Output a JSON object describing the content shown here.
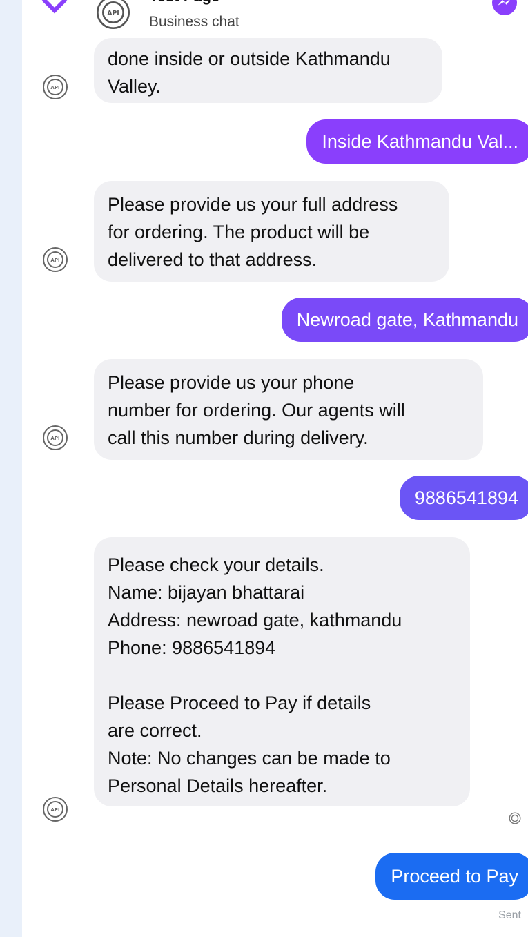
{
  "header": {
    "title": "Test Page",
    "subtitle": "Business chat"
  },
  "messages": [
    {
      "from": "bot",
      "text": "done inside or outside Kathmandu\nValley."
    },
    {
      "from": "user",
      "text": "Inside Kathmandu Val..."
    },
    {
      "from": "bot",
      "text": "Please provide us your full address\nfor ordering. The product will be\ndelivered to that address."
    },
    {
      "from": "user",
      "text": "Newroad gate, Kathmandu"
    },
    {
      "from": "bot",
      "text": "Please provide us your phone\nnumber for ordering. Our agents will\ncall this number during delivery."
    },
    {
      "from": "user",
      "text": "9886541894"
    },
    {
      "from": "bot",
      "text": "Please check your details.\nName: bijayan bhattarai\nAddress: newroad gate, kathmandu\nPhone: 9886541894\n\nPlease Proceed to Pay if details\nare correct.\nNote: No changes can be made to\nPersonal Details hereafter."
    },
    {
      "from": "user",
      "text": "Proceed to Pay"
    }
  ],
  "status": {
    "sent_label": "Sent"
  },
  "avatar_badge": "API",
  "icons": {
    "back": "chevron-left-icon",
    "avatar": "api-gear-icon",
    "messenger": "messenger-icon"
  },
  "colors": {
    "user_bubble_purple": "#8a3ffc",
    "user_bubble_indigo": "#6b55f5",
    "user_bubble_blue": "#1b6cf2",
    "bot_bubble": "#f0f0f3",
    "page_background": "#e9f0fa"
  }
}
